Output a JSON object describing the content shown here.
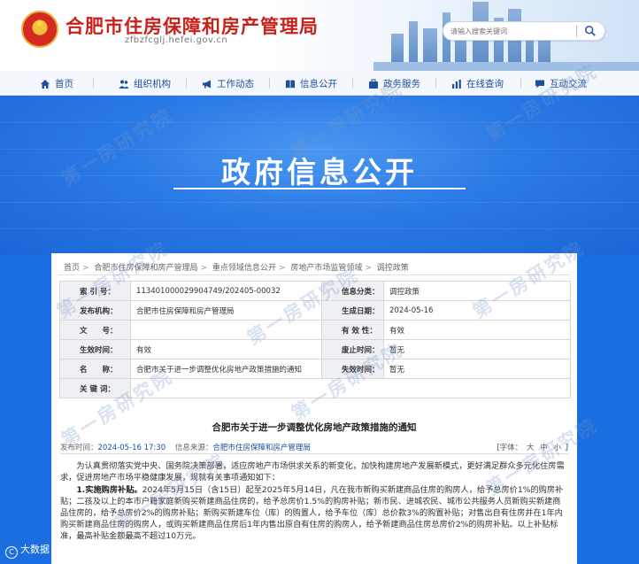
{
  "header": {
    "site_title": "合肥市住房保障和房产管理局",
    "site_domain": "zfbzfcglj.hefei.gov.cn",
    "search_placeholder": "请输入搜索关键词"
  },
  "nav": {
    "items": [
      {
        "label": "首页",
        "icon": "home-icon"
      },
      {
        "label": "组织机构",
        "icon": "people-icon"
      },
      {
        "label": "工作动态",
        "icon": "megaphone-icon"
      },
      {
        "label": "信息公开",
        "icon": "book-icon"
      },
      {
        "label": "政务服务",
        "icon": "service-icon"
      },
      {
        "label": "在线查询",
        "icon": "chart-icon"
      },
      {
        "label": "互动交流",
        "icon": "chat-icon"
      }
    ]
  },
  "banner": {
    "title": "政府信息公开"
  },
  "breadcrumb": [
    "首页",
    "合肥市住房保障和房产管理局",
    "重点领域信息公开",
    "房地产市场监管领域",
    "调控政策"
  ],
  "meta": {
    "rows": [
      {
        "l1": "索 引 号：",
        "v1": "11340100002990474​9/202405-00032",
        "l2": "信息分类：",
        "v2": "调控政策"
      },
      {
        "l1": "发布机构：",
        "v1": "合肥市住房保障和房产管理局",
        "l2": "生成日期：",
        "v2": "2024-05-16"
      },
      {
        "l1": "文　　号：",
        "v1": "",
        "l2": "有 效 性：",
        "v2": "有效"
      },
      {
        "l1": "生效时间：",
        "v1": "有效",
        "l2": "废止时间：",
        "v2": "暂无"
      },
      {
        "l1": "名　　称：",
        "v1": "合肥市关于进一步调整优化房地产政策措施的通知",
        "l2": "失效时间：",
        "v2": "暂无"
      },
      {
        "l1": "关 键 词：",
        "v1": "",
        "l2": "",
        "v2": ""
      }
    ]
  },
  "article": {
    "title": "合肥市关于进一步调整优化房地产政策措施的通知",
    "pub_time_label": "发布时间：",
    "pub_time": "2024-05-16 17:30",
    "source_label": "信息来源：",
    "source": "合肥市住房保障和房产管理局",
    "fontsize_label": "[字体：",
    "fontsize_options": [
      "大",
      "中",
      "小"
    ],
    "fontsize_close": "]",
    "para1": "为认真贯彻落实党中央、国务院决策部署，适应房地产市场供求关系的新变化，加快构建房地产发展新模式，更好满足群众多元化住房需求，促进房地产市场平稳健康发展，现就有关事项通知如下：",
    "para2_bold": "1.实施购房补贴。",
    "para2": "2024年5月15日（含15日）起至2025年5月14日，凡在我市新购买新建商品住房的购房人，给予总房价1%的购房补贴；二孩及以上的本市户籍家庭新购买新建商品住房的，给予总房价1.5%的购房补贴；新市民、进城农民、城市公共服务人员新购买新建商品住房的，给予总房价2%的购房补贴；新购买新建车位（库）的购置人，给予车位（库）总价款3%的购置补贴；对售出自有住房并在1年内购买新建商品住房的购房人，或购买新建商品住房后1年内售出原自有住房的购房人，给予新建商品住房总房价2%的购房补贴。以上补贴标准，最高补贴金额最高不超过10万元。"
  },
  "watermark": {
    "text": "第一房研究院"
  },
  "corner_logo": {
    "mark": "C",
    "text": "大数据"
  },
  "colors": {
    "brand_red": "#c9201a",
    "nav_blue": "#1d4f9e",
    "banner_blue": "#2a7ae6"
  }
}
